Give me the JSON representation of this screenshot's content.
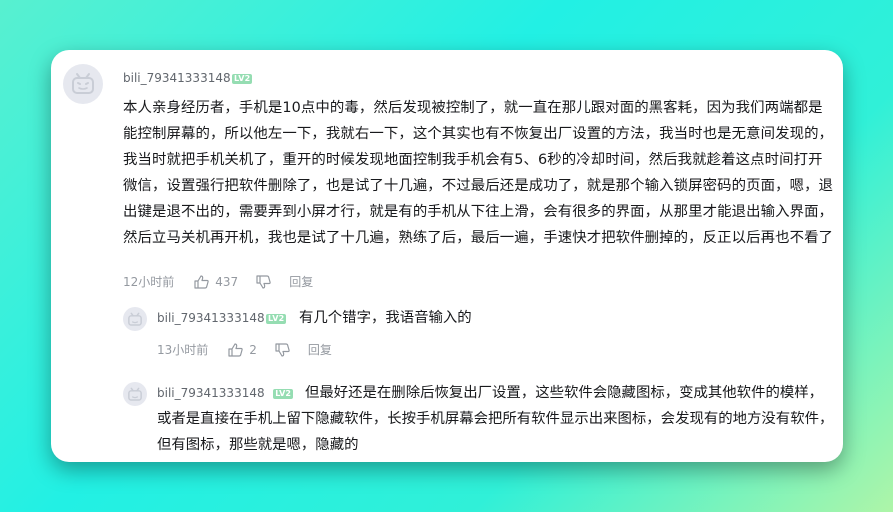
{
  "main_comment": {
    "username": "bili_79341333148",
    "level": "LV2",
    "content": "本人亲身经历者，手机是10点中的毒，然后发现被控制了，就一直在那儿跟对面的黑客耗，因为我们两端都是能控制屏幕的，所以他左一下，我就右一下，这个其实也有不恢复出厂设置的方法，我当时也是无意间发现的，我当时就把手机关机了，重开的时候发现地面控制我手机会有5、6秒的冷却时间，然后我就趁着这点时间打开微信，设置强行把软件删除了，也是试了十几遍，不过最后还是成功了，就是那个输入锁屏密码的页面，嗯，退出键是退不出的，需要弄到小屏才行，就是有的手机从下往上滑，会有很多的界面，从那里才能退出输入界面，然后立马关机再开机，我也是试了十几遍，熟练了后，最后一遍，手速快才把软件删掉的，反正以后再也不看了",
    "time": "12小时前",
    "likes": "437",
    "reply_label": "回复"
  },
  "replies": [
    {
      "username": "bili_79341333148",
      "level": "LV2",
      "content": "有几个错字，我语音输入的",
      "time": "13小时前",
      "likes": "2",
      "reply_label": "回复"
    },
    {
      "username": "bili_79341333148",
      "level": "LV2",
      "content": "但最好还是在删除后恢复出厂设置，这些软件会隐藏图标，变成其他软件的模样，或者是直接在手机上留下隐藏软件，长按手机屏幕会把所有软件显示出来图标，会发现有的地方没有软件，但有图标，那些就是嗯，隐藏的"
    }
  ],
  "icons": {
    "avatar": "bilibili-tv-avatar-icon",
    "like": "thumb-up-icon",
    "dislike": "thumb-down-icon"
  },
  "colors": {
    "level_badge": "#95ddb2",
    "username": "#61666d",
    "meta": "#9499a0",
    "text": "#18191c"
  }
}
